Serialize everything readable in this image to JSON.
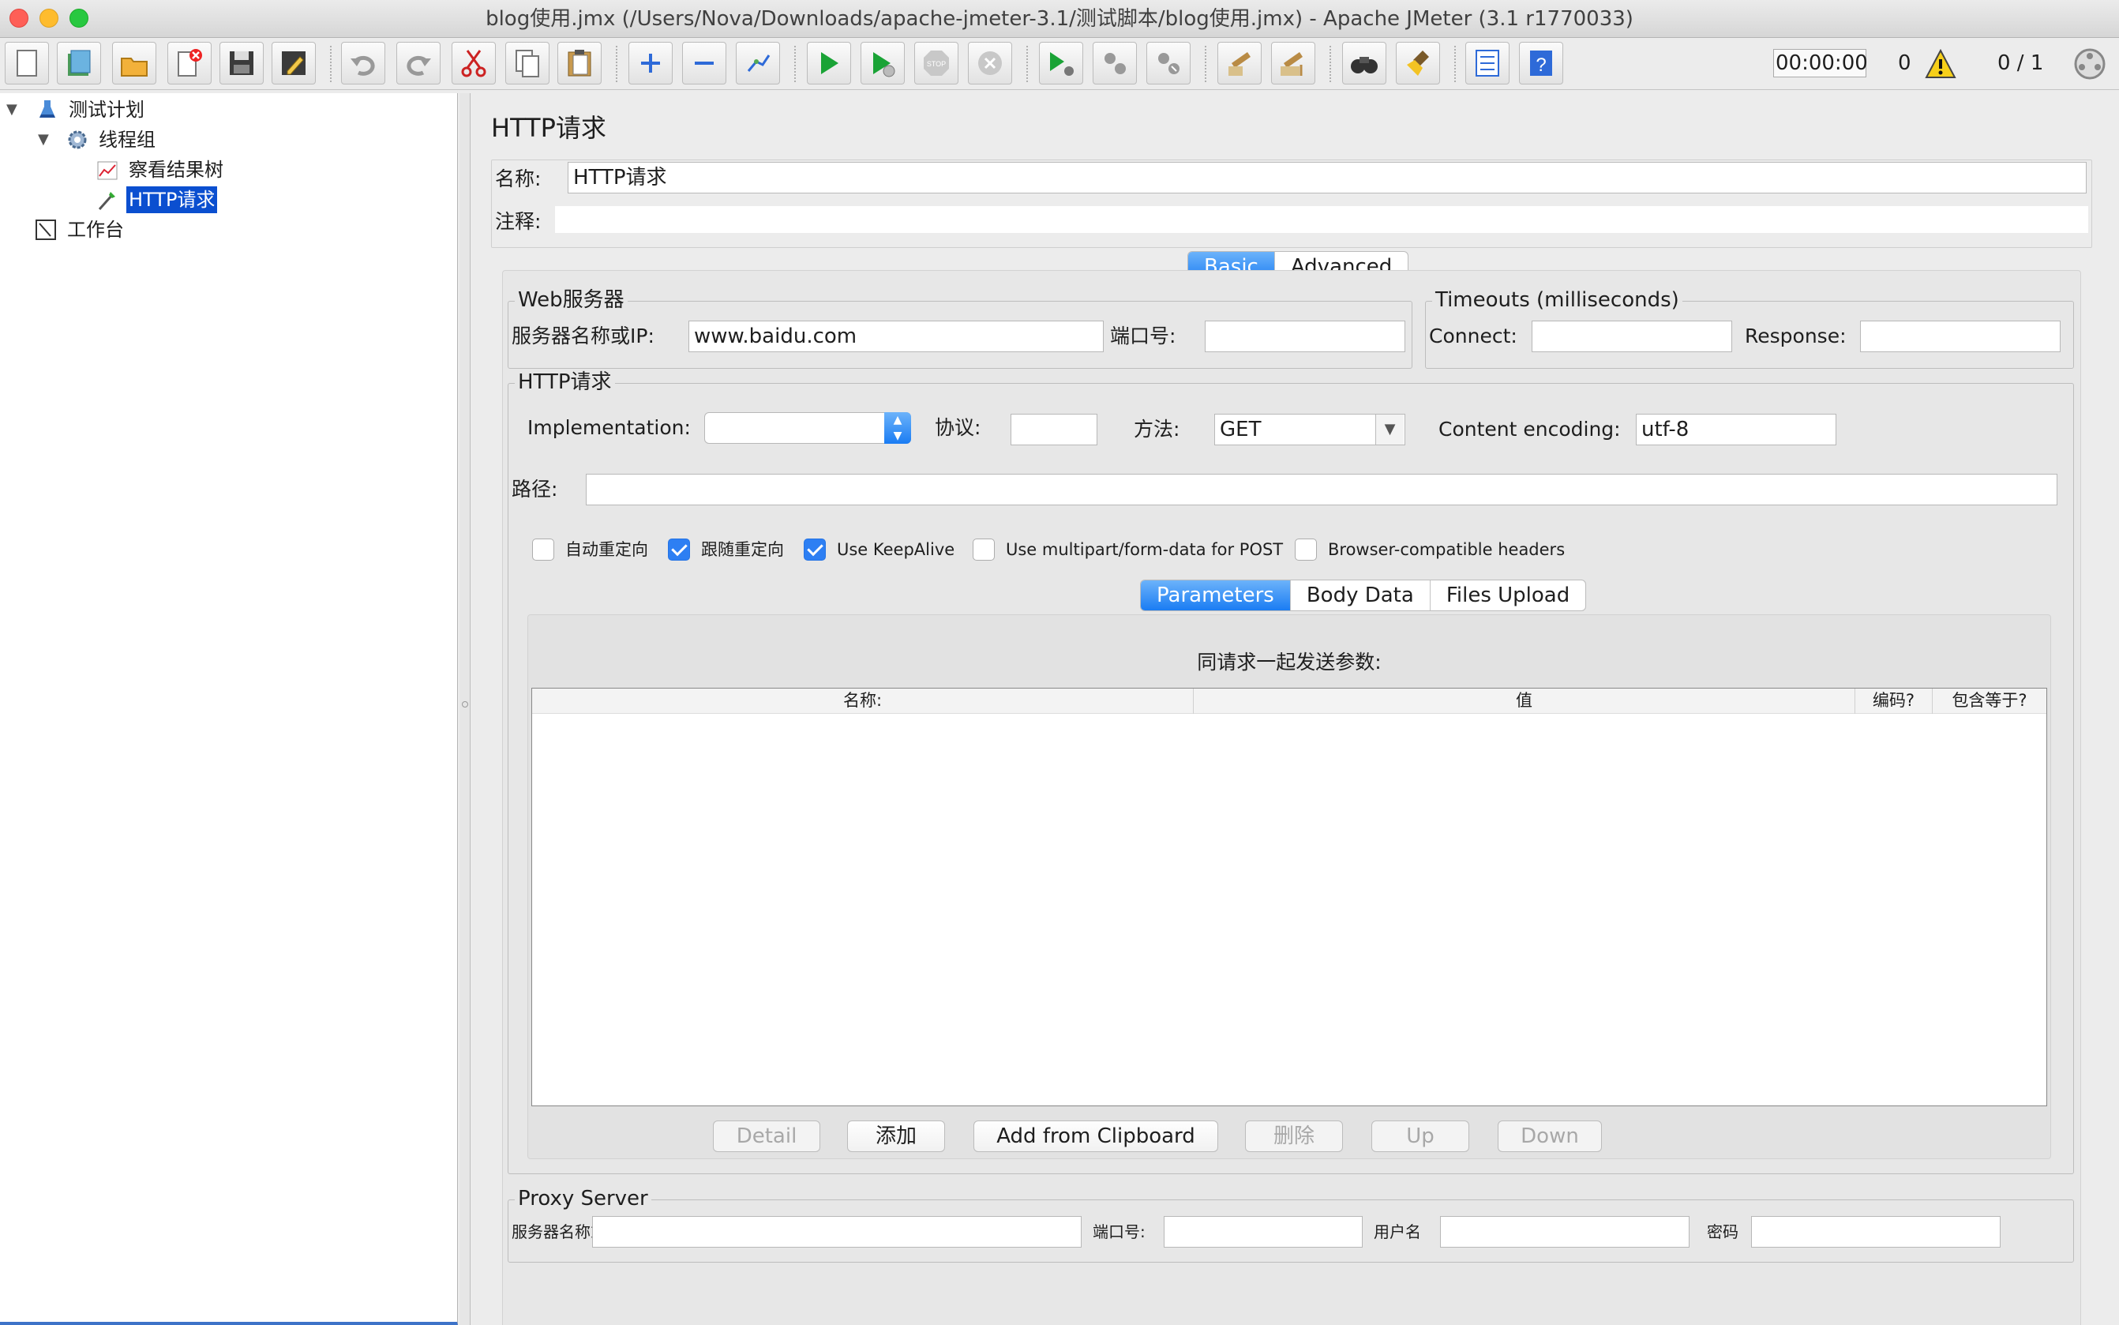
{
  "window": {
    "title": "blog使用.jmx (/Users/Nova/Downloads/apache-jmeter-3.1/测试脚本/blog使用.jmx) - Apache JMeter (3.1 r1770033)",
    "controls": {
      "close": "#fe5f57",
      "minimize": "#febc2e",
      "maximize": "#28c840"
    }
  },
  "toolbar": {
    "buttons": [
      "new-icon",
      "templates-icon",
      "open-icon",
      "close-file-icon",
      "save-icon",
      "save-as-icon",
      "undo-icon",
      "redo-icon",
      "cut-icon",
      "copy-icon",
      "paste-icon",
      "expand-icon",
      "collapse-icon",
      "toggle-icon",
      "start-icon",
      "start-no-pause-icon",
      "stop-icon",
      "shutdown-icon",
      "remote-start-icon",
      "remote-stop-icon",
      "remote-shutdown-icon",
      "clear-icon",
      "clear-all-icon",
      "search-icon",
      "reset-search-icon",
      "function-helper-icon",
      "help-icon"
    ],
    "timer": "00:00:00",
    "error_count": "0",
    "threads": "0 / 1"
  },
  "tree": {
    "nodes": [
      {
        "label": "测试计划",
        "icon": "test-plan-icon"
      },
      {
        "label": "线程组",
        "icon": "thread-group-icon"
      },
      {
        "label": "察看结果树",
        "icon": "results-tree-icon"
      },
      {
        "label": "HTTP请求",
        "icon": "http-sampler-icon",
        "selected": true
      },
      {
        "label": "工作台",
        "icon": "workbench-icon"
      }
    ]
  },
  "panel": {
    "title": "HTTP请求",
    "name_label": "名称:",
    "name_value": "HTTP请求",
    "comment_label": "注释:",
    "comment_value": "",
    "tabs": [
      "Basic",
      "Advanced"
    ],
    "active_tab": "Basic"
  },
  "web_server": {
    "legend": "Web服务器",
    "server_label": "服务器名称或IP:",
    "server_value": "www.baidu.com",
    "port_label": "端口号:",
    "port_value": ""
  },
  "timeouts": {
    "legend": "Timeouts (milliseconds)",
    "connect_label": "Connect:",
    "connect_value": "",
    "response_label": "Response:",
    "response_value": ""
  },
  "http_request": {
    "legend": "HTTP请求",
    "implementation_label": "Implementation:",
    "implementation_value": "",
    "protocol_label": "协议:",
    "protocol_value": "",
    "method_label": "方法:",
    "method_value": "GET",
    "encoding_label": "Content encoding:",
    "encoding_value": "utf-8",
    "path_label": "路径:",
    "path_value": "",
    "checkboxes": [
      {
        "label": "自动重定向",
        "checked": false
      },
      {
        "label": "跟随重定向",
        "checked": true
      },
      {
        "label": "Use KeepAlive",
        "checked": true
      },
      {
        "label": "Use multipart/form-data for POST",
        "checked": false
      },
      {
        "label": "Browser-compatible headers",
        "checked": false
      }
    ]
  },
  "params": {
    "tabs": [
      "Parameters",
      "Body Data",
      "Files Upload"
    ],
    "active_tab": "Parameters",
    "caption": "同请求一起发送参数:",
    "columns": [
      "名称:",
      "值",
      "编码?",
      "包含等于?"
    ],
    "rows": [],
    "buttons": [
      {
        "label": "Detail",
        "enabled": false
      },
      {
        "label": "添加",
        "enabled": true
      },
      {
        "label": "Add from Clipboard",
        "enabled": true
      },
      {
        "label": "删除",
        "enabled": false
      },
      {
        "label": "Up",
        "enabled": false
      },
      {
        "label": "Down",
        "enabled": false
      }
    ]
  },
  "proxy": {
    "legend": "Proxy Server",
    "server_label": "服务器名称或IP:",
    "server_value": "",
    "port_label": "端口号:",
    "port_value": "",
    "user_label": "用户名",
    "user_value": "",
    "password_label": "密码",
    "password_value": ""
  }
}
